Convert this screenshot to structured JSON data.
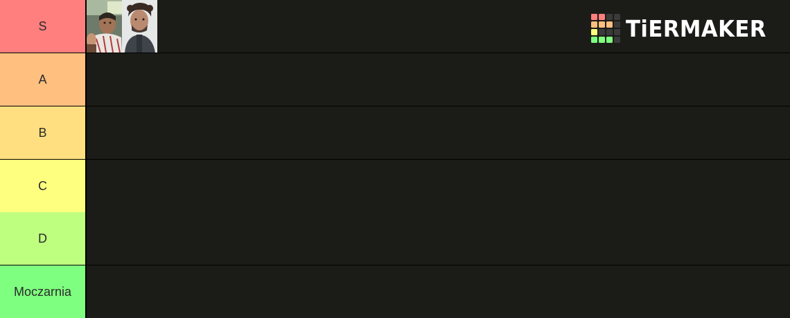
{
  "app": {
    "logo_text": "TiERMAKER"
  },
  "colors": {
    "item_area": "#1b1c18",
    "tier_s": "#ff7f7f",
    "tier_a": "#ffbf7f",
    "tier_b": "#ffdf7f",
    "tier_c": "#ffff7f",
    "tier_d": "#bfff7f",
    "tier_moczarnia": "#7fff7f"
  },
  "tiers": [
    {
      "label": "S",
      "color": "#ff7f7f",
      "items": [
        "photo-man-with-scarf",
        "photo-man-curly-hair"
      ]
    },
    {
      "label": "A",
      "color": "#ffbf7f",
      "items": []
    },
    {
      "label": "B",
      "color": "#ffdf7f",
      "items": []
    },
    {
      "label": "C",
      "color": "#ffff7f",
      "items": []
    },
    {
      "label": "D",
      "color": "#bfff7f",
      "items": []
    },
    {
      "label": "Moczarnia",
      "color": "#7fff7f",
      "items": []
    }
  ]
}
